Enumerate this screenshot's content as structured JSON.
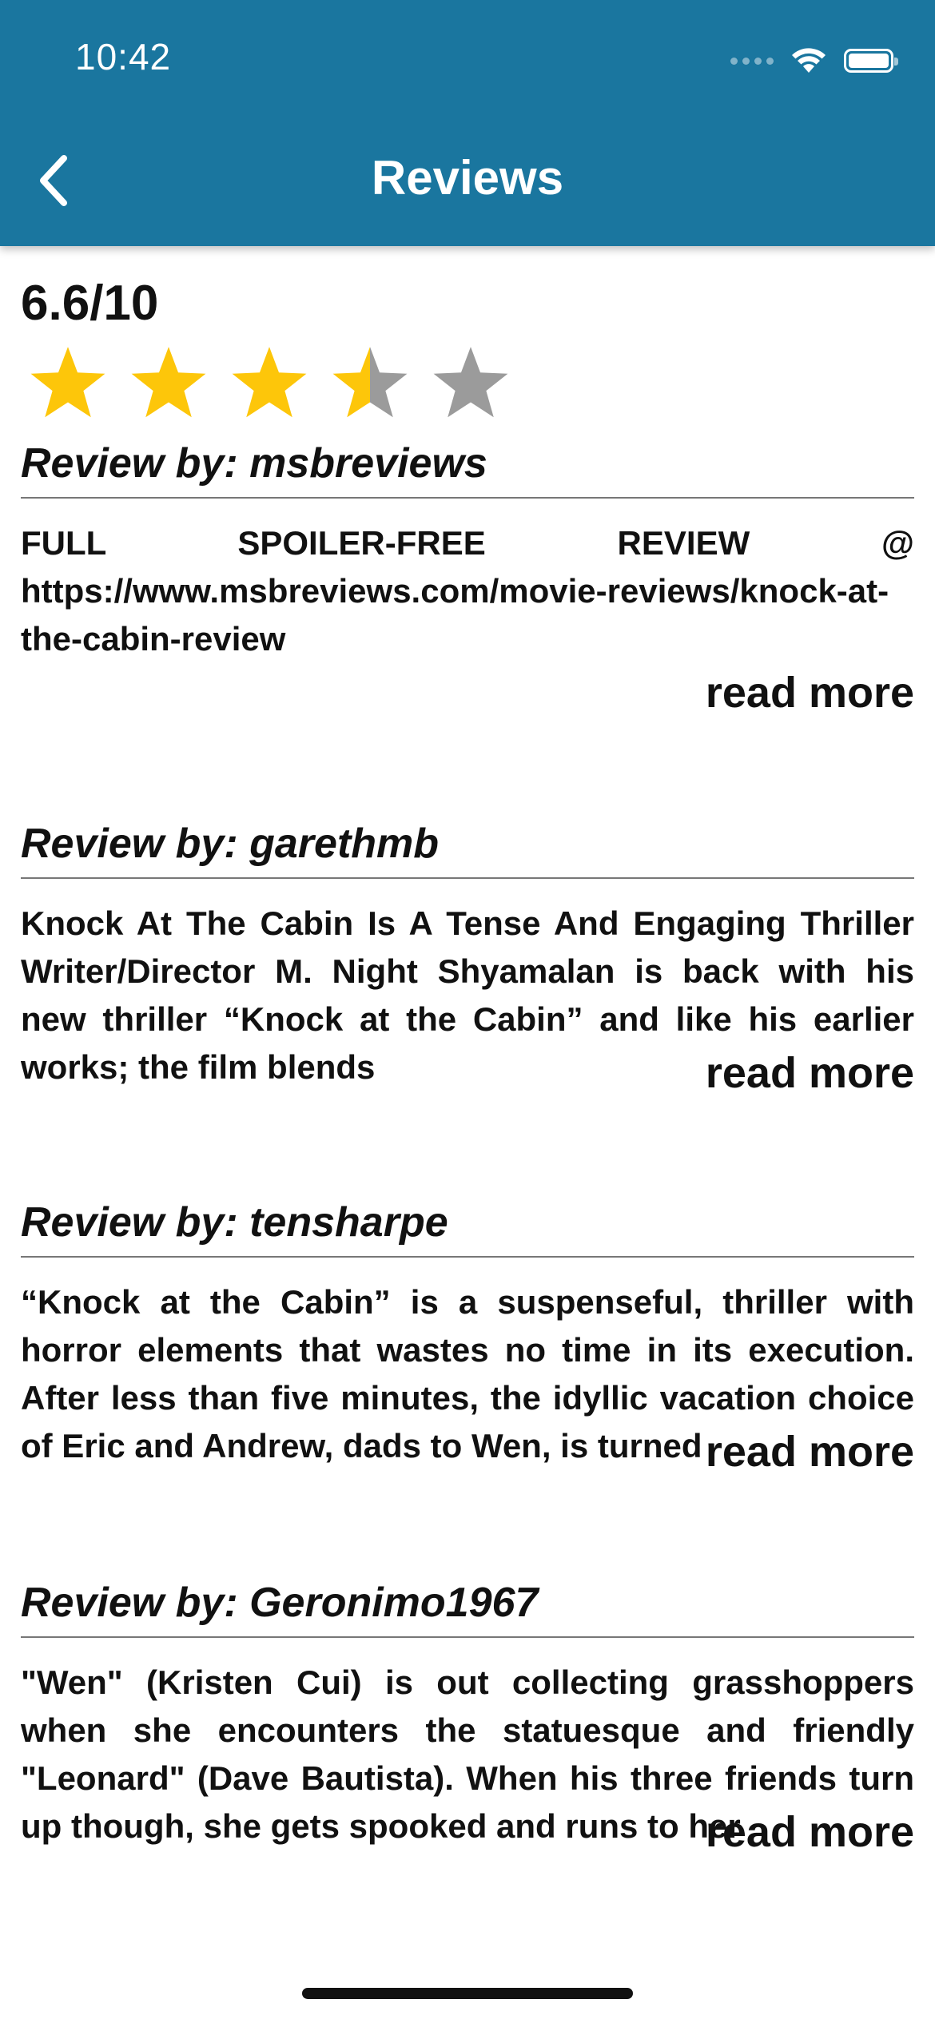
{
  "status_bar": {
    "time": "10:42"
  },
  "header": {
    "title": "Reviews",
    "back_icon": "chevron-left-icon"
  },
  "rating": {
    "text": "6.6/10",
    "value": 6.6,
    "max": 10,
    "stars_filled": 3.5,
    "stars_total": 5,
    "star_color": "#fdc60a",
    "star_empty_color": "#9b9b9b"
  },
  "colors": {
    "header_bg": "#1a769f",
    "text": "#111111"
  },
  "reviews": [
    {
      "by": "Review by: msbreviews",
      "body": "FULL SPOILER-FREE REVIEW @ https://www.msbreviews.com/movie-reviews/knock-at-the-cabin-review",
      "read_more": "read more"
    },
    {
      "by": "Review by: garethmb",
      "body": "Knock At The Cabin Is A Tense And Engaging Thriller Writer/Director M. Night Shyamalan is back with his new thriller “Knock at the Cabin” and like his earlier works; the film blends",
      "read_more": "read more"
    },
    {
      "by": "Review by: tensharpe",
      "body": "“Knock at the Cabin” is a suspenseful, thriller with horror elements that wastes no time in its execution. After less than five minutes, the idyllic vacation choice of Eric and Andrew, dads to Wen, is turned",
      "read_more": "read more"
    },
    {
      "by": "Review by: Geronimo1967",
      "body": "\"Wen\" (Kristen Cui) is out collecting grasshoppers when she encounters the statuesque and friendly \"Leonard\" (Dave Bautista). When his three friends turn up though, she gets spooked and runs to her",
      "read_more": "read more"
    }
  ]
}
